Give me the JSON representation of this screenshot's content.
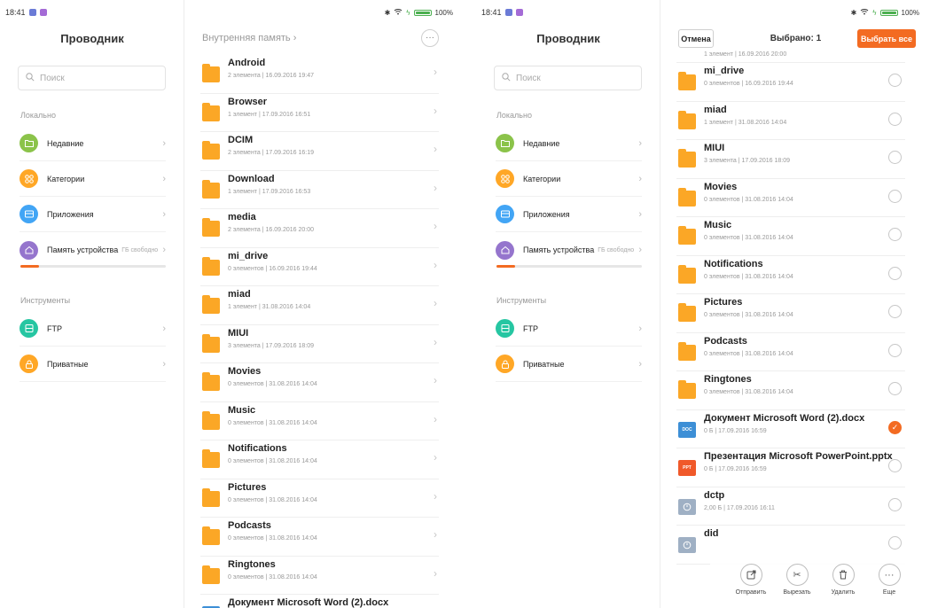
{
  "status": {
    "time": "18:41",
    "battery_text": "100%",
    "battery_level": 1.0
  },
  "sidebar": {
    "title": "Проводник",
    "search_placeholder": "Поиск",
    "section_local": "Локально",
    "section_tools": "Инструменты",
    "recent": "Недавние",
    "categories": "Категории",
    "apps": "Приложения",
    "storage": "Память устройства",
    "storage_free": "ГБ свободно",
    "storage_used_fraction": 0.13,
    "ftp": "FTP",
    "private": "Приватные"
  },
  "left_panel": {
    "breadcrumb": "Внутренняя память",
    "files": [
      {
        "name": "Android",
        "meta": "2 элемента | 16.09.2016 19:47"
      },
      {
        "name": "Browser",
        "meta": "1 элемент | 17.09.2016 16:51"
      },
      {
        "name": "DCIM",
        "meta": "2 элемента | 17.09.2016 16:19"
      },
      {
        "name": "Download",
        "meta": "1 элемент | 17.09.2016 16:53"
      },
      {
        "name": "media",
        "meta": "2 элемента | 16.09.2016 20:00"
      },
      {
        "name": "mi_drive",
        "meta": "0 элементов | 16.09.2016 19:44"
      },
      {
        "name": "miad",
        "meta": "1 элемент | 31.08.2016 14:04"
      },
      {
        "name": "MIUI",
        "meta": "3 элемента | 17.09.2016 18:09"
      },
      {
        "name": "Movies",
        "meta": "0 элементов | 31.08.2016 14:04"
      },
      {
        "name": "Music",
        "meta": "0 элементов | 31.08.2016 14:04"
      },
      {
        "name": "Notifications",
        "meta": "0 элементов | 31.08.2016 14:04"
      },
      {
        "name": "Pictures",
        "meta": "0 элементов | 31.08.2016 14:04"
      },
      {
        "name": "Podcasts",
        "meta": "0 элементов | 31.08.2016 14:04"
      },
      {
        "name": "Ringtones",
        "meta": "0 элементов | 31.08.2016 14:04"
      },
      {
        "name": "Документ Microsoft Word (2).docx",
        "meta": ""
      }
    ]
  },
  "right_panel": {
    "cancel_label": "Отмена",
    "selected_label": "Выбрано: 1",
    "select_all_label": "Выбрать все",
    "partial_meta": "1 элемент | 16.09.2016 20:00",
    "files": [
      {
        "name": "mi_drive",
        "meta": "0 элементов | 16.09.2016 19:44",
        "type": "folder",
        "selected": false
      },
      {
        "name": "miad",
        "meta": "1 элемент | 31.08.2016 14:04",
        "type": "folder",
        "selected": false
      },
      {
        "name": "MIUI",
        "meta": "3 элемента | 17.09.2016 18:09",
        "type": "folder",
        "selected": false
      },
      {
        "name": "Movies",
        "meta": "0 элементов | 31.08.2016 14:04",
        "type": "folder",
        "selected": false
      },
      {
        "name": "Music",
        "meta": "0 элементов | 31.08.2016 14:04",
        "type": "folder",
        "selected": false
      },
      {
        "name": "Notifications",
        "meta": "0 элементов | 31.08.2016 14:04",
        "type": "folder",
        "selected": false
      },
      {
        "name": "Pictures",
        "meta": "0 элементов | 31.08.2016 14:04",
        "type": "folder",
        "selected": false
      },
      {
        "name": "Podcasts",
        "meta": "0 элементов | 31.08.2016 14:04",
        "type": "folder",
        "selected": false
      },
      {
        "name": "Ringtones",
        "meta": "0 элементов | 31.08.2016 14:04",
        "type": "folder",
        "selected": false
      },
      {
        "name": "Документ Microsoft Word (2).docx",
        "meta": "0 Б | 17.09.2016 16:59",
        "type": "doc",
        "badge": "DOC",
        "selected": true
      },
      {
        "name": "Презентация Microsoft PowerPoint.pptx",
        "meta": "0 Б | 17.09.2016 16:59",
        "type": "ppt",
        "badge": "PPT",
        "selected": false
      },
      {
        "name": "dctp",
        "meta": "2,00 Б | 17.09.2016 16:11",
        "type": "unknown",
        "selected": false
      },
      {
        "name": "did",
        "meta": "",
        "type": "unknown",
        "selected": false
      }
    ],
    "actions": {
      "send": "Отправить",
      "cut": "Вырезать",
      "delete": "Удалить",
      "more": "Еще"
    }
  },
  "colors": {
    "accent": "#f36b22",
    "folder": "#fba726",
    "recent": "#8bc34a",
    "categories": "#ffa726",
    "apps": "#42a5f5",
    "storage": "#9575cd",
    "ftp": "#26c6a2",
    "private": "#ffa726",
    "doc": "#3d8fd6",
    "ppt": "#f0592a",
    "unknown": "#9fb0c4"
  }
}
